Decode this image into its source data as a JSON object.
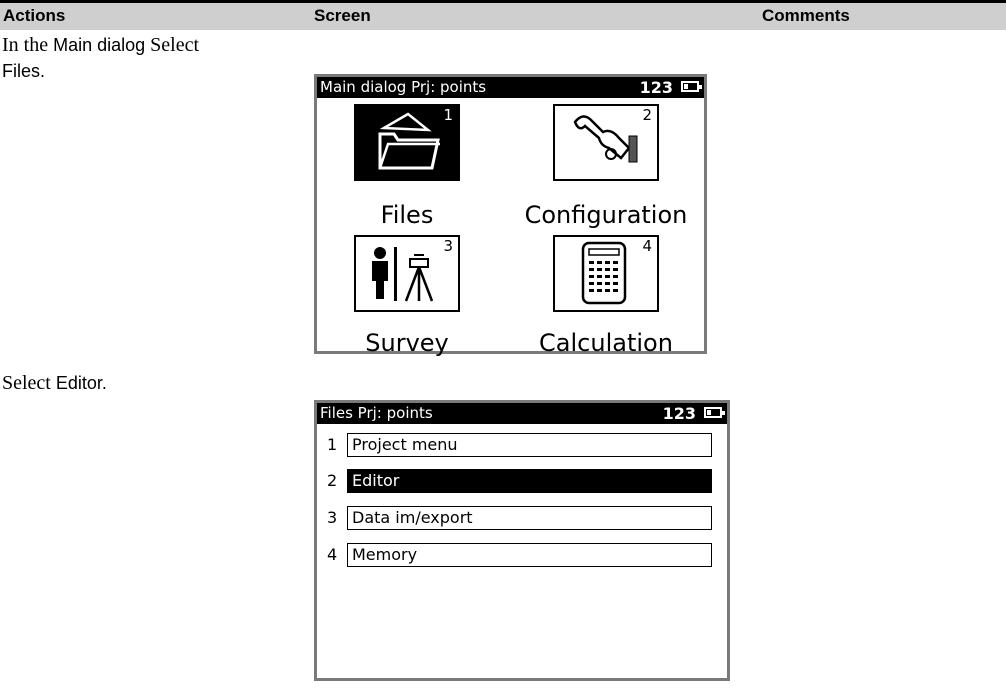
{
  "header": {
    "actions": "Actions",
    "screen": "Screen",
    "comments": "Comments"
  },
  "step1": {
    "line1_serif": "In the ",
    "line1_sans": "Main dialog",
    "line1_tail": " Select",
    "line2": "Files."
  },
  "step2": {
    "serif": "Select ",
    "sans": "Editor."
  },
  "main_screen": {
    "title": "Main dialog  Prj: points",
    "status": "123",
    "icons": [
      {
        "num": "1",
        "label": "Files",
        "selected": true
      },
      {
        "num": "2",
        "label": "Configuration",
        "selected": false
      },
      {
        "num": "3",
        "label": "Survey",
        "selected": false
      },
      {
        "num": "4",
        "label": "Calculation",
        "selected": false
      }
    ]
  },
  "files_screen": {
    "title": "Files  Prj: points",
    "status": "123",
    "items": [
      {
        "num": "1",
        "label": "Project menu",
        "selected": false
      },
      {
        "num": "2",
        "label": "Editor",
        "selected": true
      },
      {
        "num": "3",
        "label": "Data im/export",
        "selected": false
      },
      {
        "num": "4",
        "label": "Memory",
        "selected": false
      }
    ]
  }
}
